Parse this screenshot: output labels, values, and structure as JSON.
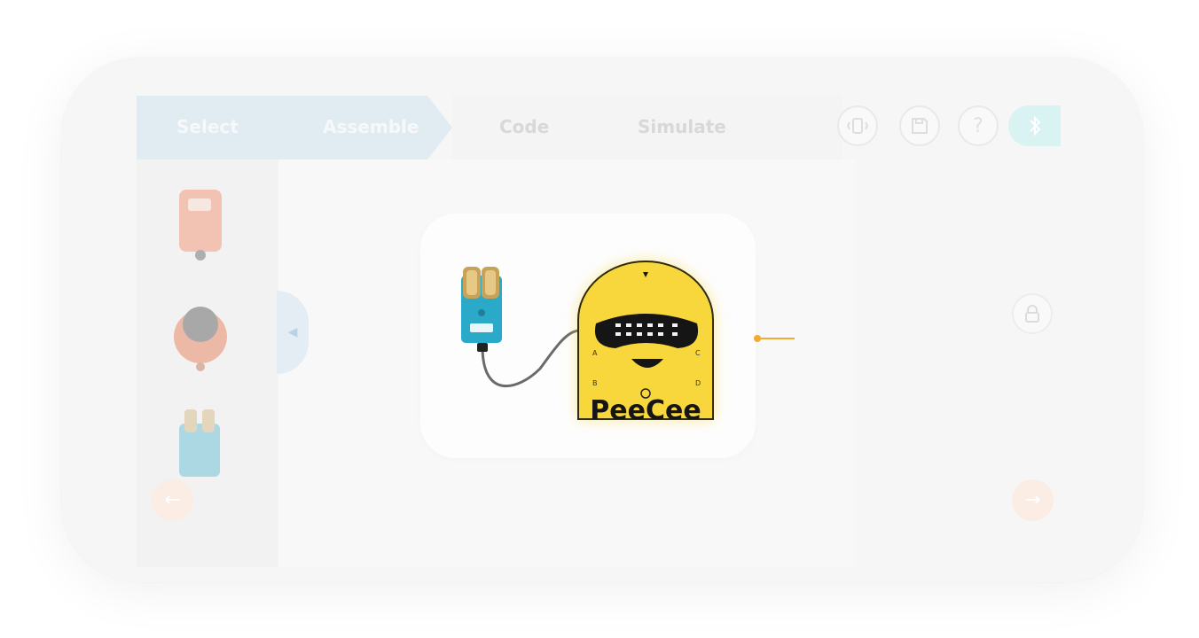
{
  "steps": [
    {
      "label": "Select",
      "active": false
    },
    {
      "label": "Assemble",
      "active": true
    },
    {
      "label": "Code",
      "active": false
    },
    {
      "label": "Simulate",
      "active": false
    }
  ],
  "toolbar": {
    "help_label": "?"
  },
  "robot": {
    "port_labels": [
      "A",
      "B",
      "C",
      "D"
    ],
    "brand": "PeeCee"
  },
  "colors": {
    "step_active_bg": "#e0ecf1",
    "robot_yellow": "#f8d73c",
    "sensor_teal": "#2ba9c9",
    "callout": "#f3aa2e",
    "nav_orange": "#fbece4"
  },
  "icons": {
    "vibrate": "vibrate-icon",
    "save": "save-icon",
    "help": "help-icon",
    "bluetooth": "bluetooth-icon",
    "lock": "lock-icon",
    "prev": "arrow-left-icon",
    "next": "arrow-right-icon",
    "collapse": "chevron-left-icon"
  }
}
